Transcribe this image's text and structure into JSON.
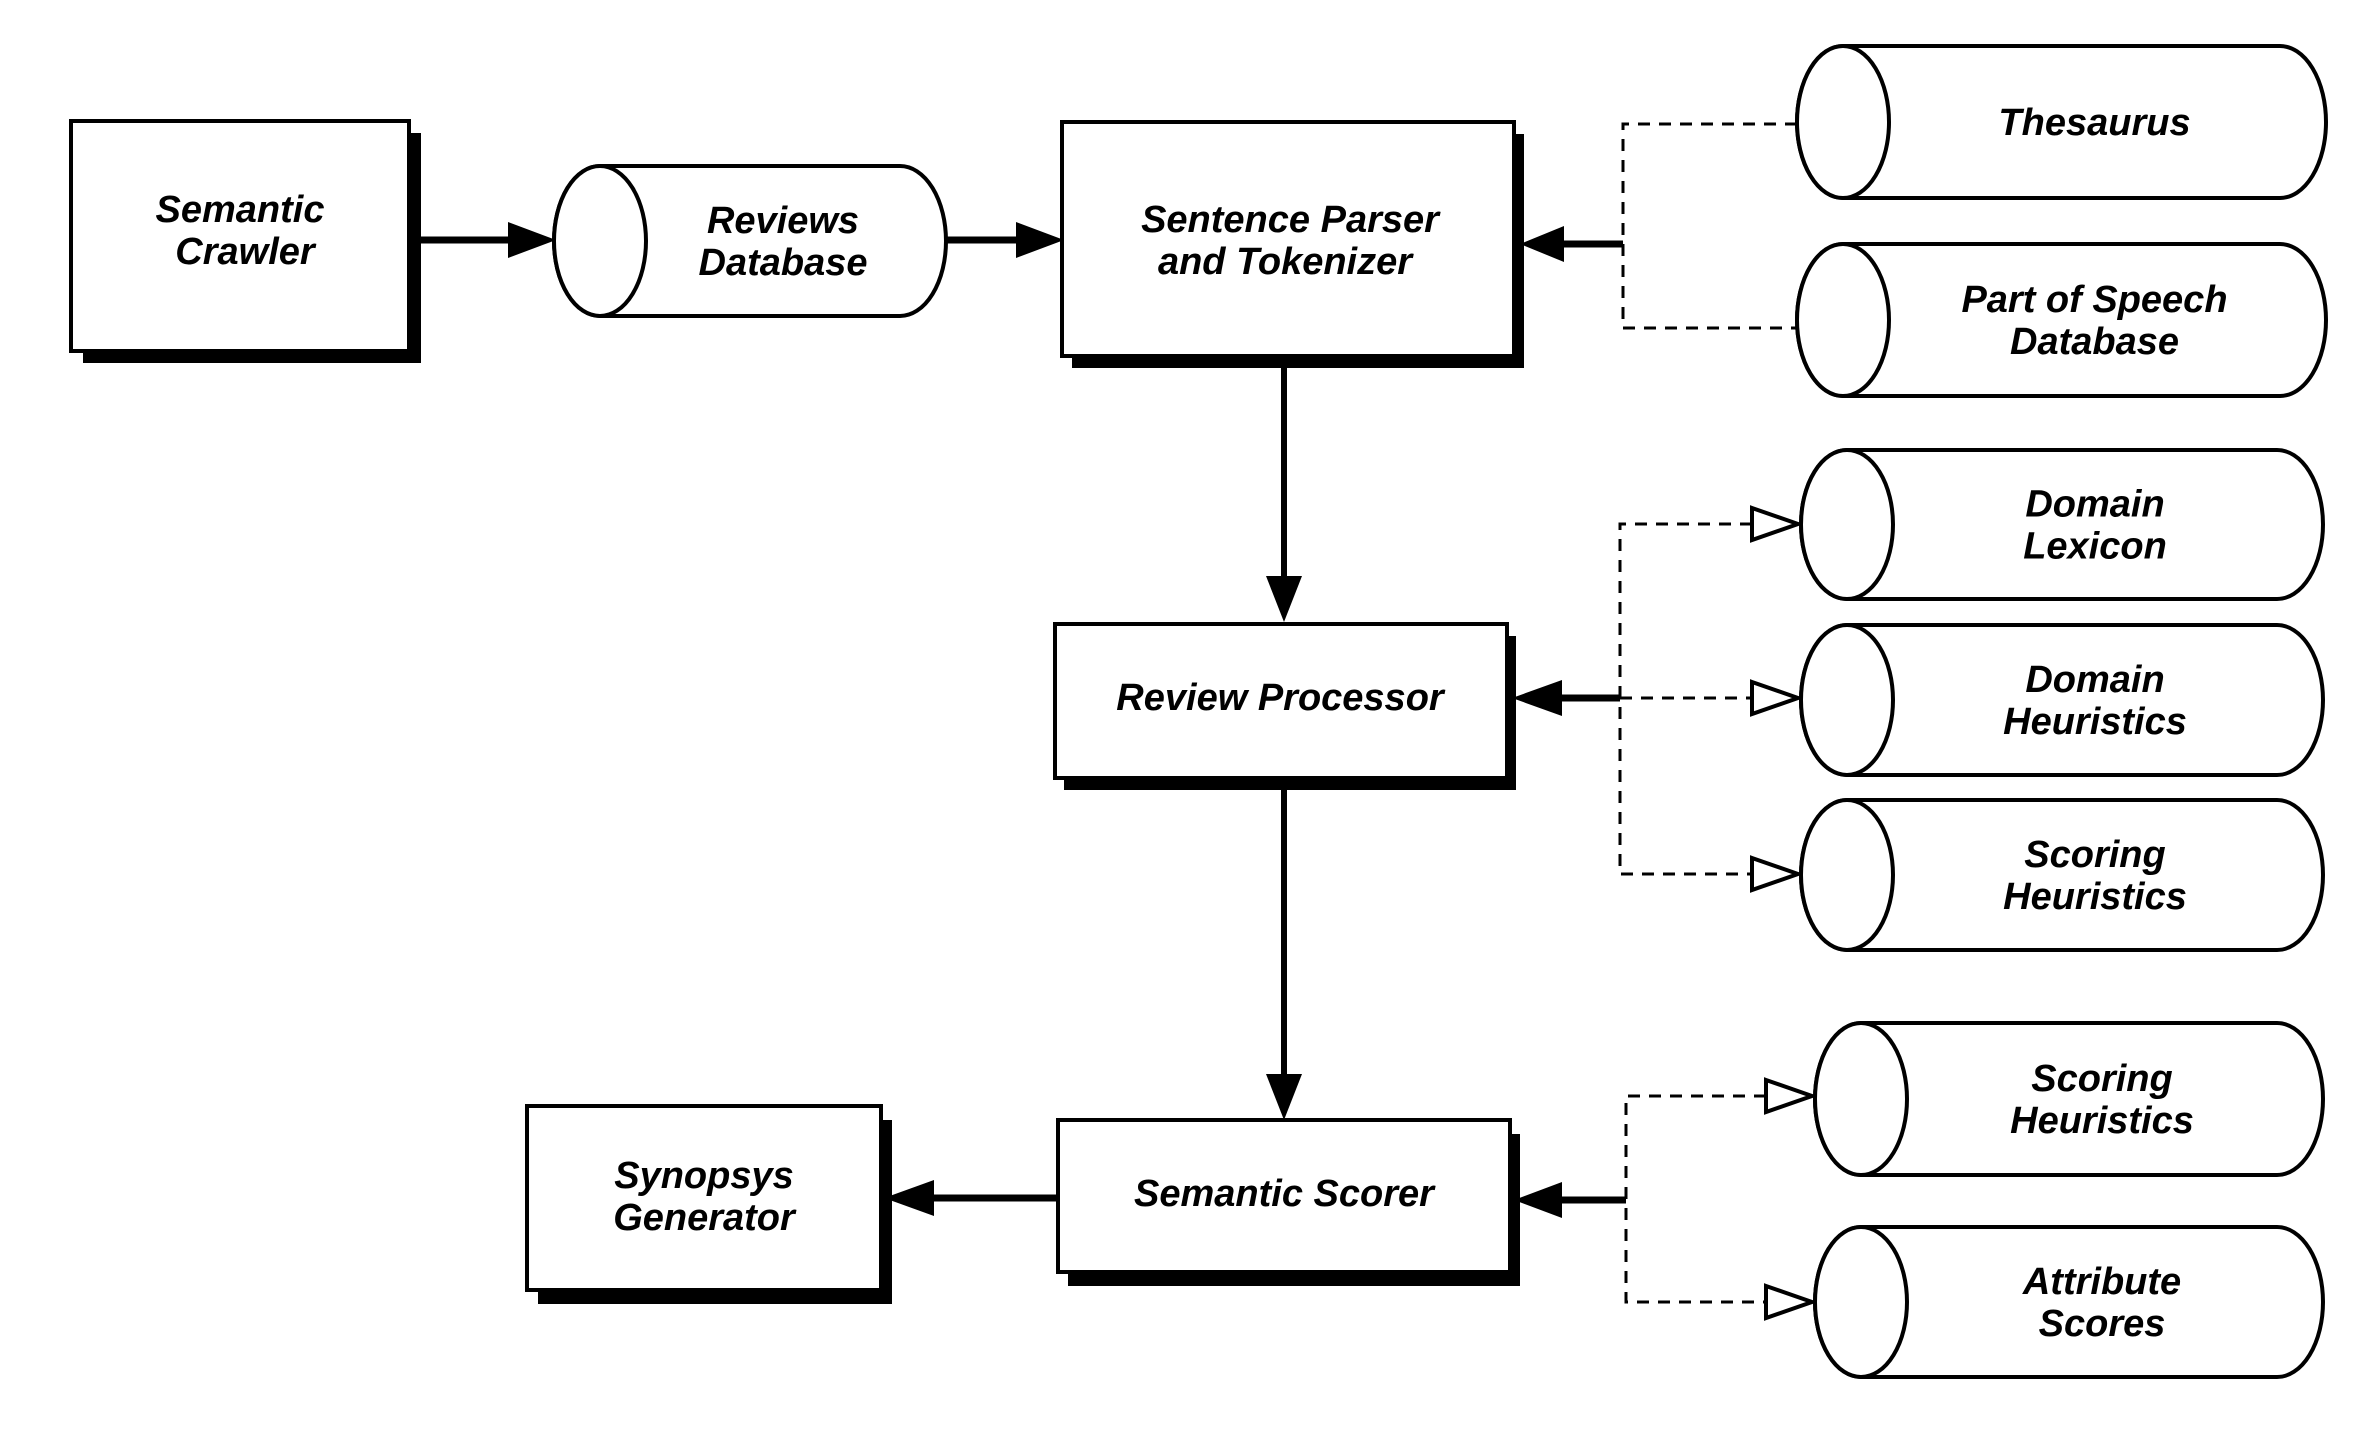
{
  "diagram": {
    "nodes": [
      {
        "id": "semantic-crawler",
        "kind": "process",
        "lines": [
          "Semantic",
          "Crawler"
        ]
      },
      {
        "id": "reviews-database",
        "kind": "datastore",
        "lines": [
          "Reviews",
          "Database"
        ]
      },
      {
        "id": "sentence-parser",
        "kind": "process",
        "lines": [
          "Sentence Parser",
          "and Tokenizer"
        ]
      },
      {
        "id": "thesaurus",
        "kind": "datastore",
        "lines": [
          "Thesaurus"
        ]
      },
      {
        "id": "part-of-speech-database",
        "kind": "datastore",
        "lines": [
          "Part of Speech",
          "Database"
        ]
      },
      {
        "id": "domain-lexicon",
        "kind": "datastore",
        "lines": [
          "Domain",
          "Lexicon"
        ]
      },
      {
        "id": "domain-heuristics",
        "kind": "datastore",
        "lines": [
          "Domain",
          "Heuristics"
        ]
      },
      {
        "id": "scoring-heuristics-1",
        "kind": "datastore",
        "lines": [
          "Scoring",
          "Heuristics"
        ]
      },
      {
        "id": "review-processor",
        "kind": "process",
        "lines": [
          "Review Processor"
        ]
      },
      {
        "id": "scoring-heuristics-2",
        "kind": "datastore",
        "lines": [
          "Scoring",
          "Heuristics"
        ]
      },
      {
        "id": "attribute-scores",
        "kind": "datastore",
        "lines": [
          "Attribute",
          "Scores"
        ]
      },
      {
        "id": "semantic-scorer",
        "kind": "process",
        "lines": [
          "Semantic Scorer"
        ]
      },
      {
        "id": "synopsys-generator",
        "kind": "process",
        "lines": [
          "Synopsys",
          "Generator"
        ]
      }
    ],
    "edges": [
      {
        "from": "semantic-crawler",
        "to": "reviews-database",
        "style": "solid"
      },
      {
        "from": "reviews-database",
        "to": "sentence-parser",
        "style": "solid"
      },
      {
        "from": "thesaurus",
        "to": "sentence-parser",
        "style": "dashed-merge"
      },
      {
        "from": "part-of-speech-database",
        "to": "sentence-parser",
        "style": "dashed-merge"
      },
      {
        "from": "sentence-parser",
        "to": "review-processor",
        "style": "solid"
      },
      {
        "from": "review-processor",
        "to": "domain-lexicon",
        "style": "dashed-open-arrow"
      },
      {
        "from": "review-processor",
        "to": "domain-heuristics",
        "style": "dashed-open-arrow"
      },
      {
        "from": "review-processor",
        "to": "scoring-heuristics-1",
        "style": "dashed-open-arrow"
      },
      {
        "from": "review-processor",
        "to": "semantic-scorer",
        "style": "solid"
      },
      {
        "from": "semantic-scorer",
        "to": "scoring-heuristics-2",
        "style": "dashed-open-arrow"
      },
      {
        "from": "semantic-scorer",
        "to": "attribute-scores",
        "style": "dashed-open-arrow"
      },
      {
        "from": "semantic-scorer",
        "to": "synopsys-generator",
        "style": "solid"
      }
    ]
  }
}
